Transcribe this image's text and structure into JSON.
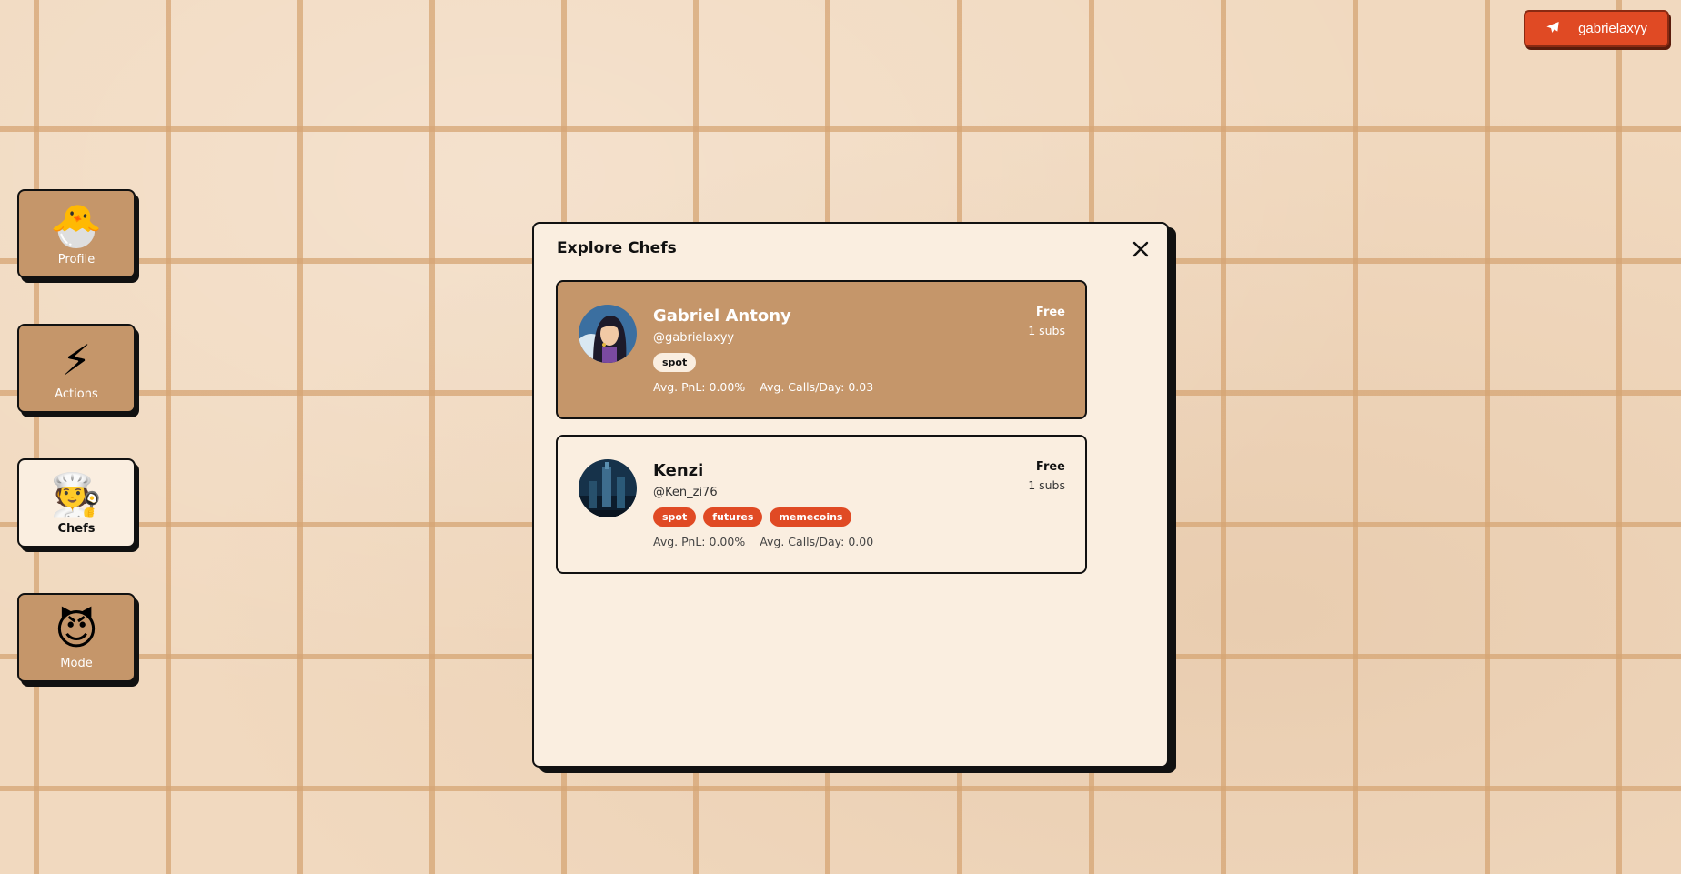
{
  "header": {
    "user_button_label": "gabrielaxyy",
    "user_button_icon": "telegram-icon",
    "accent_color": "#e04a24"
  },
  "sidebar": {
    "items": [
      {
        "label": "Profile",
        "icon": "🐣",
        "icon_name": "hatching-chick-icon"
      },
      {
        "label": "Actions",
        "icon": "⚡",
        "icon_name": "lightning-icon"
      },
      {
        "label": "Chefs",
        "icon": "🧑‍🍳",
        "icon_name": "chef-icon",
        "active": true
      },
      {
        "label": "Mode",
        "icon": "😈",
        "icon_name": "devil-icon"
      }
    ]
  },
  "modal": {
    "title": "Explore Chefs",
    "close_icon": "close-icon",
    "chefs": [
      {
        "name": "Gabriel Antony",
        "handle": "@gabrielaxyy",
        "tags": [
          "spot"
        ],
        "avg_pnl": "Avg. PnL: 0.00%",
        "avg_calls": "Avg. Calls/Day: 0.03",
        "price": "Free",
        "subs": "1 subs",
        "selected": true
      },
      {
        "name": "Kenzi",
        "handle": "@Ken_zi76",
        "tags": [
          "spot",
          "futures",
          "memecoins"
        ],
        "avg_pnl": "Avg. PnL: 0.00%",
        "avg_calls": "Avg. Calls/Day: 0.00",
        "price": "Free",
        "subs": "1 subs",
        "selected": false
      }
    ]
  }
}
